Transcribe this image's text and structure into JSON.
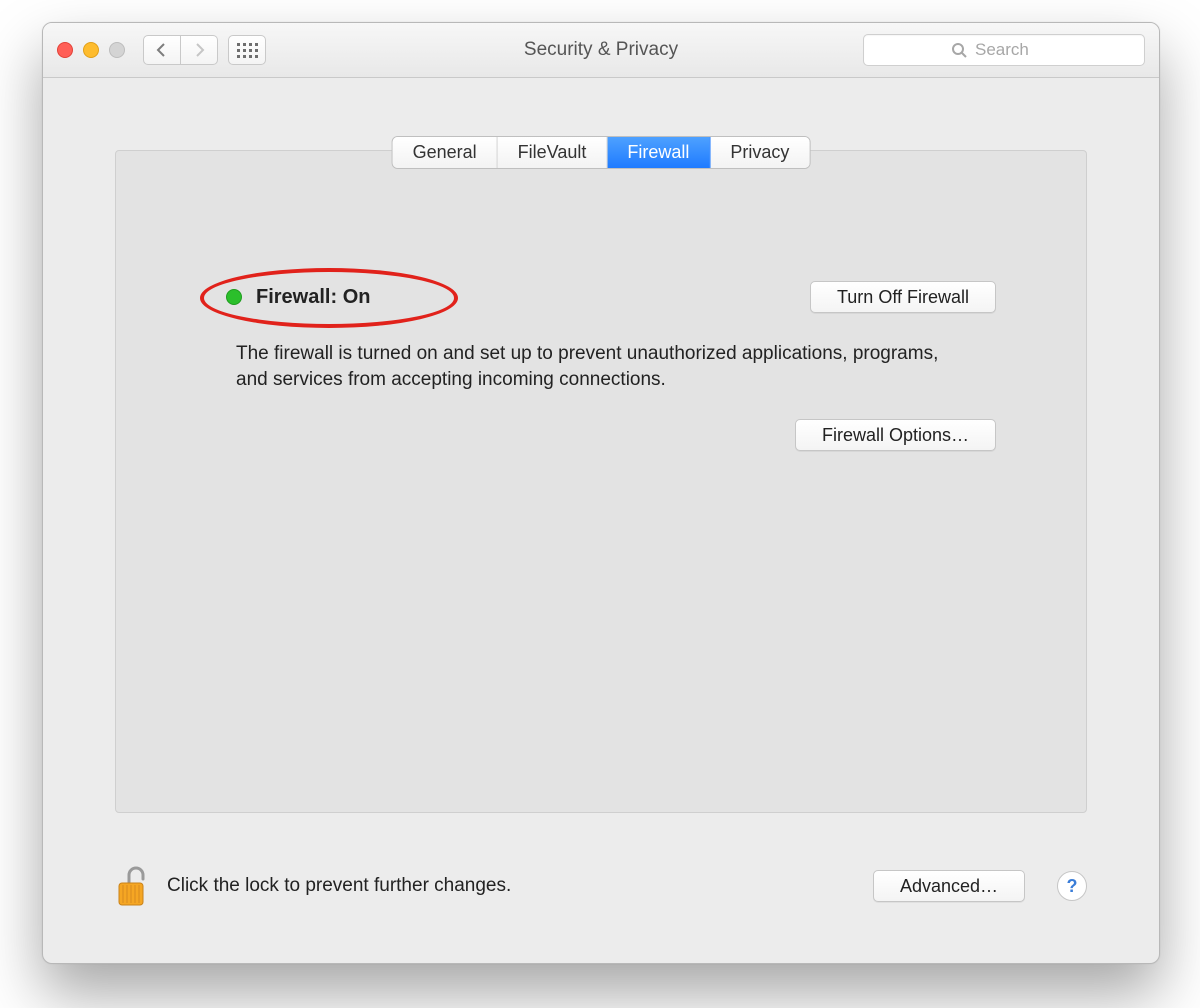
{
  "window": {
    "title": "Security & Privacy"
  },
  "search": {
    "placeholder": "Search",
    "value": ""
  },
  "tabs": {
    "t0": "General",
    "t1": "FileVault",
    "t2": "Firewall",
    "t3": "Privacy",
    "selected": "Firewall"
  },
  "firewall": {
    "status_label": "Firewall: On",
    "status_color": "#2bbf2b",
    "toggle_button": "Turn Off Firewall",
    "description": "The firewall is turned on and set up to prevent unauthorized applications, programs, and services from accepting incoming connections.",
    "options_button": "Firewall Options…"
  },
  "footer": {
    "lock_state": "unlocked",
    "message": "Click the lock to prevent further changes.",
    "advanced_button": "Advanced…",
    "help_label": "?"
  },
  "annotation": {
    "red_ellipse_on_status": true
  }
}
